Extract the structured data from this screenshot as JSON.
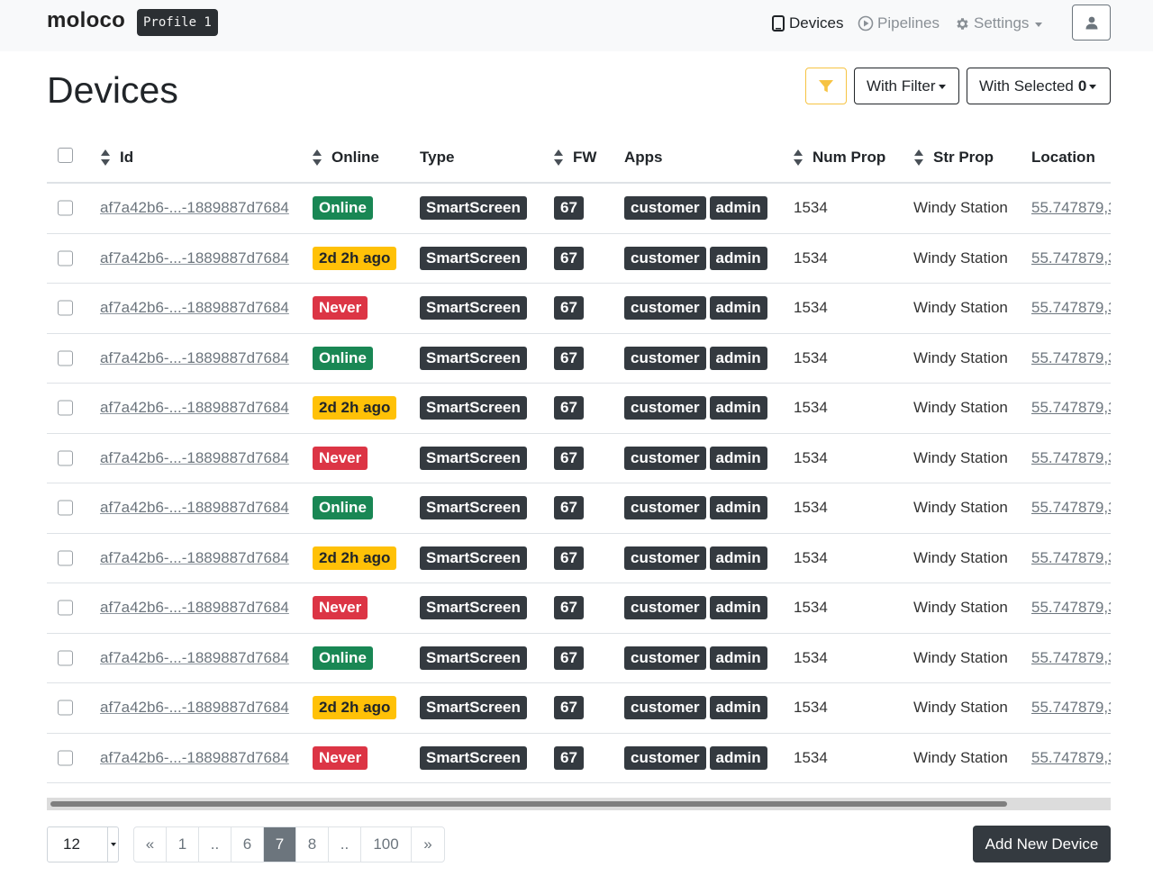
{
  "navbar": {
    "brand": "moloco",
    "profile": "Profile 1",
    "links": {
      "devices": "Devices",
      "pipelines": "Pipelines",
      "settings": "Settings"
    }
  },
  "header": {
    "title": "Devices",
    "with_filter": "With Filter",
    "with_selected": "With Selected",
    "selected_count": "0"
  },
  "colors": {
    "filter_accent": "#f6c343",
    "online": "#198754",
    "warn": "#ffc107",
    "never": "#dc3545",
    "dark": "#343a40"
  },
  "table": {
    "columns": [
      "Id",
      "Online",
      "Type",
      "FW",
      "Apps",
      "Num Prop",
      "Str Prop",
      "Location"
    ],
    "rows": [
      {
        "id": "af7a42b6-...-1889887d7684",
        "status": "Online",
        "status_kind": "online",
        "type": "SmartScreen",
        "fw": "67",
        "apps": [
          "customer",
          "admin"
        ],
        "num_prop": "1534",
        "str_prop": "Windy Station",
        "location": "55.747879,3"
      },
      {
        "id": "af7a42b6-...-1889887d7684",
        "status": "2d 2h ago",
        "status_kind": "warn",
        "type": "SmartScreen",
        "fw": "67",
        "apps": [
          "customer",
          "admin"
        ],
        "num_prop": "1534",
        "str_prop": "Windy Station",
        "location": "55.747879,3"
      },
      {
        "id": "af7a42b6-...-1889887d7684",
        "status": "Never",
        "status_kind": "never",
        "type": "SmartScreen",
        "fw": "67",
        "apps": [
          "customer",
          "admin"
        ],
        "num_prop": "1534",
        "str_prop": "Windy Station",
        "location": "55.747879,3"
      },
      {
        "id": "af7a42b6-...-1889887d7684",
        "status": "Online",
        "status_kind": "online",
        "type": "SmartScreen",
        "fw": "67",
        "apps": [
          "customer",
          "admin"
        ],
        "num_prop": "1534",
        "str_prop": "Windy Station",
        "location": "55.747879,3"
      },
      {
        "id": "af7a42b6-...-1889887d7684",
        "status": "2d 2h ago",
        "status_kind": "warn",
        "type": "SmartScreen",
        "fw": "67",
        "apps": [
          "customer",
          "admin"
        ],
        "num_prop": "1534",
        "str_prop": "Windy Station",
        "location": "55.747879,3"
      },
      {
        "id": "af7a42b6-...-1889887d7684",
        "status": "Never",
        "status_kind": "never",
        "type": "SmartScreen",
        "fw": "67",
        "apps": [
          "customer",
          "admin"
        ],
        "num_prop": "1534",
        "str_prop": "Windy Station",
        "location": "55.747879,3"
      },
      {
        "id": "af7a42b6-...-1889887d7684",
        "status": "Online",
        "status_kind": "online",
        "type": "SmartScreen",
        "fw": "67",
        "apps": [
          "customer",
          "admin"
        ],
        "num_prop": "1534",
        "str_prop": "Windy Station",
        "location": "55.747879,3"
      },
      {
        "id": "af7a42b6-...-1889887d7684",
        "status": "2d 2h ago",
        "status_kind": "warn",
        "type": "SmartScreen",
        "fw": "67",
        "apps": [
          "customer",
          "admin"
        ],
        "num_prop": "1534",
        "str_prop": "Windy Station",
        "location": "55.747879,3"
      },
      {
        "id": "af7a42b6-...-1889887d7684",
        "status": "Never",
        "status_kind": "never",
        "type": "SmartScreen",
        "fw": "67",
        "apps": [
          "customer",
          "admin"
        ],
        "num_prop": "1534",
        "str_prop": "Windy Station",
        "location": "55.747879,3"
      },
      {
        "id": "af7a42b6-...-1889887d7684",
        "status": "Online",
        "status_kind": "online",
        "type": "SmartScreen",
        "fw": "67",
        "apps": [
          "customer",
          "admin"
        ],
        "num_prop": "1534",
        "str_prop": "Windy Station",
        "location": "55.747879,3"
      },
      {
        "id": "af7a42b6-...-1889887d7684",
        "status": "2d 2h ago",
        "status_kind": "warn",
        "type": "SmartScreen",
        "fw": "67",
        "apps": [
          "customer",
          "admin"
        ],
        "num_prop": "1534",
        "str_prop": "Windy Station",
        "location": "55.747879,3"
      },
      {
        "id": "af7a42b6-...-1889887d7684",
        "status": "Never",
        "status_kind": "never",
        "type": "SmartScreen",
        "fw": "67",
        "apps": [
          "customer",
          "admin"
        ],
        "num_prop": "1534",
        "str_prop": "Windy Station",
        "location": "55.747879,3"
      }
    ]
  },
  "footer": {
    "page_size": "12",
    "pagination": [
      "«",
      "1",
      "..",
      "6",
      "7",
      "8",
      "..",
      "100",
      "»"
    ],
    "active_page": "7",
    "add_button": "Add New Device"
  }
}
